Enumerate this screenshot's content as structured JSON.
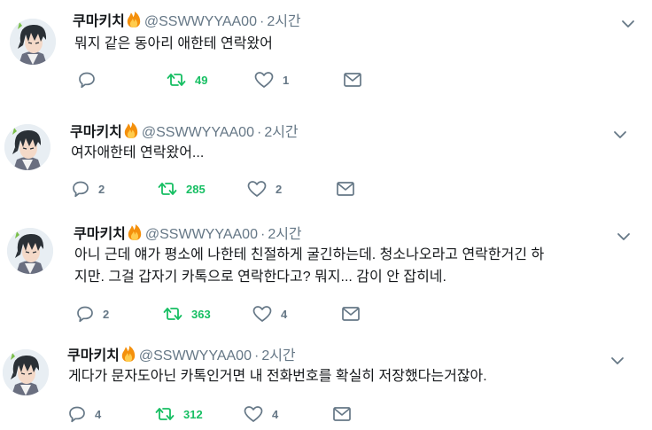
{
  "tweets": [
    {
      "name": "쿠마키치",
      "handle": "@SSWWYYAA00",
      "dot": "·",
      "time": "2시간",
      "text": "뭐지 같은 동아리 애한테 연락왔어",
      "replies": "",
      "retweets": "49",
      "likes": "1"
    },
    {
      "name": "쿠마키치",
      "handle": "@SSWWYYAA00",
      "dot": "·",
      "time": "2시간",
      "text": "여자애한테 연락왔어...",
      "replies": "2",
      "retweets": "285",
      "likes": "2"
    },
    {
      "name": "쿠마키치",
      "handle": "@SSWWYYAA00",
      "dot": "·",
      "time": "2시간",
      "text": "아니 근데 얘가 평소에 나한테 친절하게 굴긴하는데. 청소나오라고 연락한거긴 하\n지만. 그걸 갑자기 카톡으로 연락한다고? 뭐지... 감이 안 잡히네.",
      "replies": "2",
      "retweets": "363",
      "likes": "4"
    },
    {
      "name": "쿠마키치",
      "handle": "@SSWWYYAA00",
      "dot": "·",
      "time": "2시간",
      "text": "게다가 문자도아닌 카톡인거면 내 전화번호를 확실히 저장했다는거잖아.",
      "replies": "4",
      "retweets": "312",
      "likes": "4"
    }
  ],
  "colors": {
    "text": "#14171a",
    "secondary": "#657786",
    "retweet_green": "#17bf63"
  },
  "icons": [
    "reply-icon",
    "retweet-icon",
    "like-icon",
    "direct-message-icon",
    "chevron-down-icon",
    "fire-emoji-icon"
  ]
}
